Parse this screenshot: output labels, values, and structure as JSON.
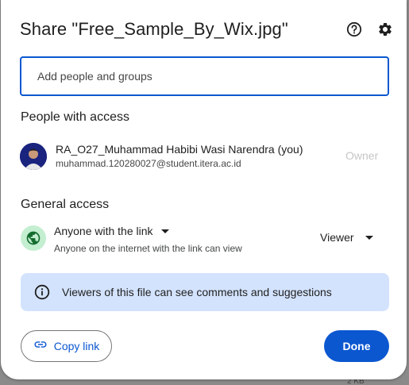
{
  "dialog": {
    "title": "Share \"Free_Sample_By_Wix.jpg\"",
    "help_icon": "help-circle-icon",
    "settings_icon": "gear-icon"
  },
  "add_people": {
    "placeholder": "Add people and groups",
    "value": ""
  },
  "people_section": {
    "heading": "People with access",
    "people": [
      {
        "name": "RA_O27_Muhammad Habibi Wasi Narendra (you)",
        "email": "muhammad.120280027@student.itera.ac.id",
        "role": "Owner"
      }
    ]
  },
  "general_access": {
    "heading": "General access",
    "option": "Anyone with the link",
    "description": "Anyone on the internet with the link can view",
    "role": "Viewer"
  },
  "info_banner": {
    "text": "Viewers of this file can see comments and suggestions"
  },
  "buttons": {
    "copy_link": "Copy link",
    "done": "Done"
  },
  "background_peek": "2 KB",
  "colors": {
    "primary": "#0b57d0",
    "banner": "#d3e3fd",
    "globe_bg": "#c4eed0",
    "muted": "#c4c7c5"
  }
}
